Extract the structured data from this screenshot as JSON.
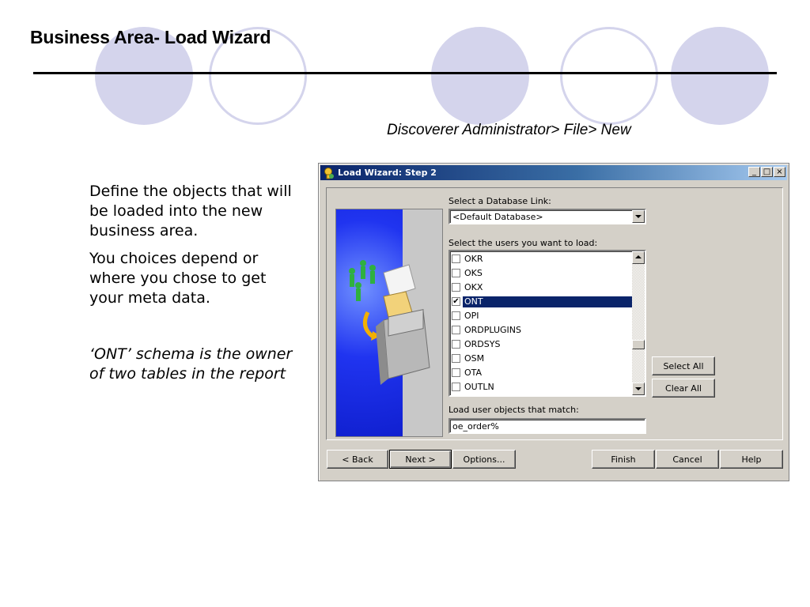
{
  "slide": {
    "title": "Business Area- Load Wizard",
    "subtitle": "Discoverer Administrator> File> New",
    "paragraphs": [
      "Define the objects that will be loaded into the new business area.",
      "You choices depend or where you chose to get your meta data."
    ],
    "note": "‘ONT’ schema is the owner of two tables in the report"
  },
  "window": {
    "title": "Load Wizard: Step 2",
    "caption": {
      "minimize": "_",
      "maximize": "□",
      "close": "×"
    },
    "db_link_label": "Select a Database Link:",
    "db_link_value": "<Default Database>",
    "users_label": "Select the users you want to load:",
    "users": [
      {
        "label": "OKR",
        "checked": false,
        "selected": false
      },
      {
        "label": "OKS",
        "checked": false,
        "selected": false
      },
      {
        "label": "OKX",
        "checked": false,
        "selected": false
      },
      {
        "label": "ONT",
        "checked": true,
        "selected": true
      },
      {
        "label": "OPI",
        "checked": false,
        "selected": false
      },
      {
        "label": "ORDPLUGINS",
        "checked": false,
        "selected": false
      },
      {
        "label": "ORDSYS",
        "checked": false,
        "selected": false
      },
      {
        "label": "OSM",
        "checked": false,
        "selected": false
      },
      {
        "label": "OTA",
        "checked": false,
        "selected": false
      },
      {
        "label": "OUTLN",
        "checked": false,
        "selected": false
      }
    ],
    "select_all": "Select All",
    "clear_all": "Clear All",
    "match_label": "Load user objects that match:",
    "match_value": "oe_order%",
    "buttons": {
      "back": "< Back",
      "next": "Next >",
      "options": "Options...",
      "finish": "Finish",
      "cancel": "Cancel",
      "help": "Help"
    }
  },
  "colors": {
    "accent_circles": "#d4d4ec",
    "titlebar_start": "#0a246a",
    "selection": "#0a246a"
  }
}
